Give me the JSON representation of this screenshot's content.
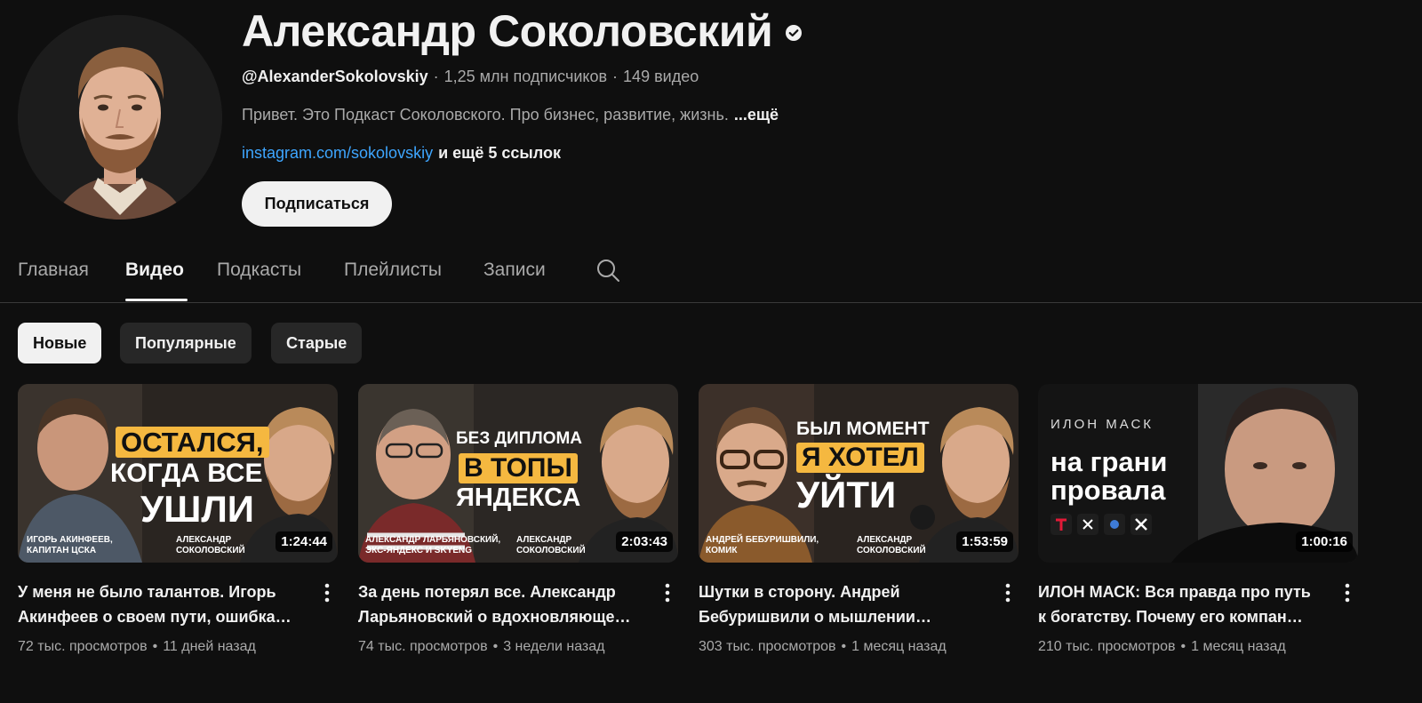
{
  "channel": {
    "name": "Александр Соколовский",
    "handle": "@AlexanderSokolovskiy",
    "subscribers": "1,25 млн подписчиков",
    "video_count": "149 видео",
    "meta_separator": "·",
    "description": "Привет. Это Подкаст Соколовского. Про бизнес, развитие, жизнь.",
    "description_more": "...ещё",
    "link": "instagram.com/sokolovskiy",
    "more_links": "и ещё 5 ссылок",
    "subscribe_label": "Подписаться",
    "verified_icon": "verified-check-icon"
  },
  "tabs": [
    {
      "label": "Главная",
      "active": false
    },
    {
      "label": "Видео",
      "active": true
    },
    {
      "label": "Подкасты",
      "active": false
    },
    {
      "label": "Плейлисты",
      "active": false
    },
    {
      "label": "Записи",
      "active": false
    }
  ],
  "search_icon": "search-icon",
  "chips": [
    {
      "label": "Новые",
      "selected": true
    },
    {
      "label": "Популярные",
      "selected": false
    },
    {
      "label": "Старые",
      "selected": false
    }
  ],
  "videos": [
    {
      "thumb_lines": [
        "Остался,",
        "когда все",
        "ушли"
      ],
      "caption_left": "Игорь Акинфеев,\nкапитан ЦСКА",
      "caption_right": "Александр\nСоколовский",
      "duration": "1:24:44",
      "title": "У меня не было талантов. Игорь Акинфеев о своем пути, ошибка…",
      "views": "72 тыс. просмотров",
      "age": "11 дней назад"
    },
    {
      "thumb_lines": [
        "Без диплома",
        "в топы",
        "Яндекса"
      ],
      "caption_left": "Александр Ларьяновский,\nэкс-Яндекс и Skyeng",
      "caption_right": "Александр\nСоколовский",
      "duration": "2:03:43",
      "title": "За день потерял все. Александр Ларьяновский о вдохновляюще…",
      "views": "74 тыс. просмотров",
      "age": "3 недели назад"
    },
    {
      "thumb_lines": [
        "Был момент",
        "я хотел",
        "уйти"
      ],
      "caption_left": "Андрей Бебуришвили,\nкомик",
      "caption_right": "Александр\nСоколовский",
      "duration": "1:53:59",
      "title": "Шутки в сторону. Андрей Бебуришвили о мышлении…",
      "views": "303 тыс. просмотров",
      "age": "1 месяц назад"
    },
    {
      "thumb_lines": [
        "Илон Маск",
        "на грани",
        "провала"
      ],
      "caption_left": "",
      "caption_right": "",
      "duration": "1:00:16",
      "title": "ИЛОН МАСК: Вся правда про путь к богатству. Почему его компан…",
      "views": "210 тыс. просмотров",
      "age": "1 месяц назад"
    }
  ],
  "meta_dot": "•",
  "colors": {
    "background": "#0f0f0f",
    "link": "#3ea6ff",
    "highlight": "#f5b840",
    "secondary_text": "#aaaaaa"
  }
}
